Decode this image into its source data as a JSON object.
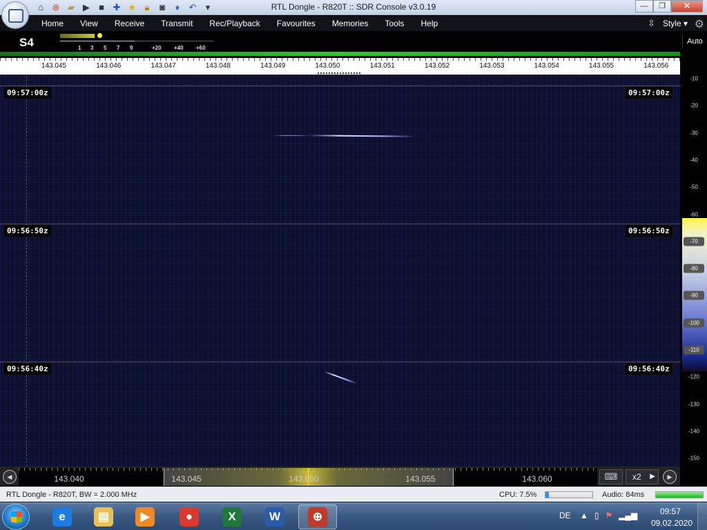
{
  "window": {
    "title": "RTL Dongle - R820T :: SDR Console v3.0.19",
    "minimize": "—",
    "maximize": "❐",
    "close": "✕"
  },
  "quick_access": [
    "home-icon",
    "help-ring-icon",
    "folder-icon",
    "play-icon",
    "stop-icon",
    "add-icon",
    "favourite-star-icon",
    "lock-icon",
    "camera-icon",
    "drop-icon",
    "undo-icon",
    "dropdown-icon"
  ],
  "menu": {
    "items": [
      "Home",
      "View",
      "Receive",
      "Transmit",
      "Rec/Playback",
      "Favourites",
      "Memories",
      "Tools",
      "Help"
    ],
    "style_label": "Style"
  },
  "smeter": {
    "reading": "S4",
    "scale": [
      "1",
      "3",
      "5",
      "7",
      "9",
      "+20",
      "+40",
      "+60"
    ]
  },
  "auto_label": "Auto",
  "frequency_ruler": [
    "143.045",
    "143.046",
    "143.047",
    "143.048",
    "143.049",
    "143.050",
    "143.051",
    "143.052",
    "143.053",
    "143.054",
    "143.055",
    "143.056"
  ],
  "waterfall": {
    "times": [
      "09:57:00z",
      "09:56:50z",
      "09:56:40z"
    ]
  },
  "db_scale": [
    "-10",
    "-20",
    "-30",
    "-40",
    "-50",
    "-60",
    "-70",
    "-80",
    "-90",
    "-100",
    "-110",
    "-120",
    "-130",
    "-140",
    "-150"
  ],
  "bottom_nav": {
    "frequencies": [
      "143.040",
      "143.045",
      "143.050",
      "143.055",
      "143.060"
    ],
    "zoom": "x2"
  },
  "status": {
    "device": "RTL Dongle - R820T, BW = 2.000 MHz",
    "cpu": "CPU: 7.5%",
    "audio": "Audio: 84ms",
    "cpu_load_fraction": 0.075,
    "audio_level_fraction": 1.0
  },
  "taskbar": {
    "apps": [
      {
        "name": "internet-explorer",
        "glyph": "e",
        "color": "#1e7be0"
      },
      {
        "name": "file-explorer",
        "glyph": "▤",
        "color": "#e7c15a"
      },
      {
        "name": "media-player",
        "glyph": "▶",
        "color": "#f08a24"
      },
      {
        "name": "chrome",
        "glyph": "●",
        "color": "#d93a2b"
      },
      {
        "name": "excel",
        "glyph": "X",
        "color": "#1f7a3a"
      },
      {
        "name": "word",
        "glyph": "W",
        "color": "#2a5aa8"
      },
      {
        "name": "sdr-console",
        "glyph": "⊕",
        "color": "#c0392b"
      }
    ],
    "language": "DE",
    "time": "09:57",
    "date": "09.02.2020"
  },
  "colors": {
    "waterfall_bg": "#0b0e2d",
    "smeter_green": "#35c335",
    "signal": "#dbe1ff"
  }
}
